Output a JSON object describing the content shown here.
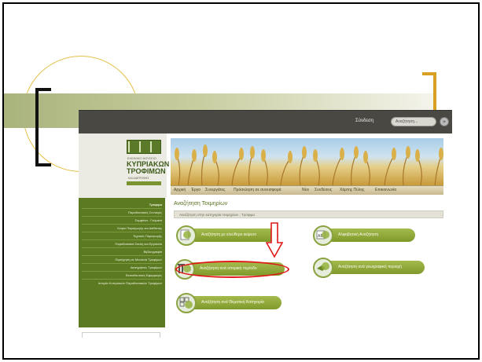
{
  "header": {
    "login": "Σύνδεση",
    "search_placeholder": "Αναζήτηση...",
    "go": "»"
  },
  "logo": {
    "line1": "ΕΙΚΟΝΙΚΟ ΜΟΥΣΕΙΟ",
    "name": "ΚΥΠΡΙΑΚΩΝ ΤΡΟΦΙΜΩΝ",
    "line3": "ΚΑΙ ΔΙΑΤΡΟΦΗΣ"
  },
  "nav": {
    "items": [
      "Αρχική",
      "Έργο",
      "Συνεργάτες",
      "Πρόσκληση σε συνεισφορά",
      "Νέα",
      "Συνδέσεις",
      "Χάρτης Πύλης",
      "Επικοινωνία"
    ]
  },
  "sidebar": {
    "items": [
      "Τρόφιμα",
      "Παραδοσιακές Συνταγές",
      "Συμφάνα - Γεύματα",
      "Χώροι Παραγωγής και Διάθεσης",
      "Τεχνικές Παραγωγής",
      "Παραδοσιακά Σκεύη και Εργαλεία",
      "Βιβλιογραφία",
      "Περιήγηση σε Μουσεία Τροφίμων",
      "Διατηρήσεις Τροφίμων",
      "Εκπαιδευτικές Εφαρμογές",
      "Ιστορία Κυπριακών Παραδοσιακών Τροφίμων"
    ]
  },
  "main": {
    "title": "Αναζήτηση Τεκμηρίων",
    "breadcrumb": "Αναζήτηση στην κατηγορία τεκμηρίων ;  Τρόφιμα",
    "buttons": {
      "free_text": "Αναζήτηση με ελεύθερο κείμενο",
      "alphabetic": "Αλφαβητική Αναζήτηση",
      "historic": "Αναζήτηση ανά ιστορική περίοδο",
      "geographic": "Αναζήτηση ανά γεωγραφική περιοχή",
      "thematic": "Αναζήτηση ανά Θεματική Κατηγορία"
    }
  },
  "colors": {
    "accent_green": "#5b7a22",
    "highlight_red": "#e01818",
    "bracket_gold": "#d8a020"
  }
}
